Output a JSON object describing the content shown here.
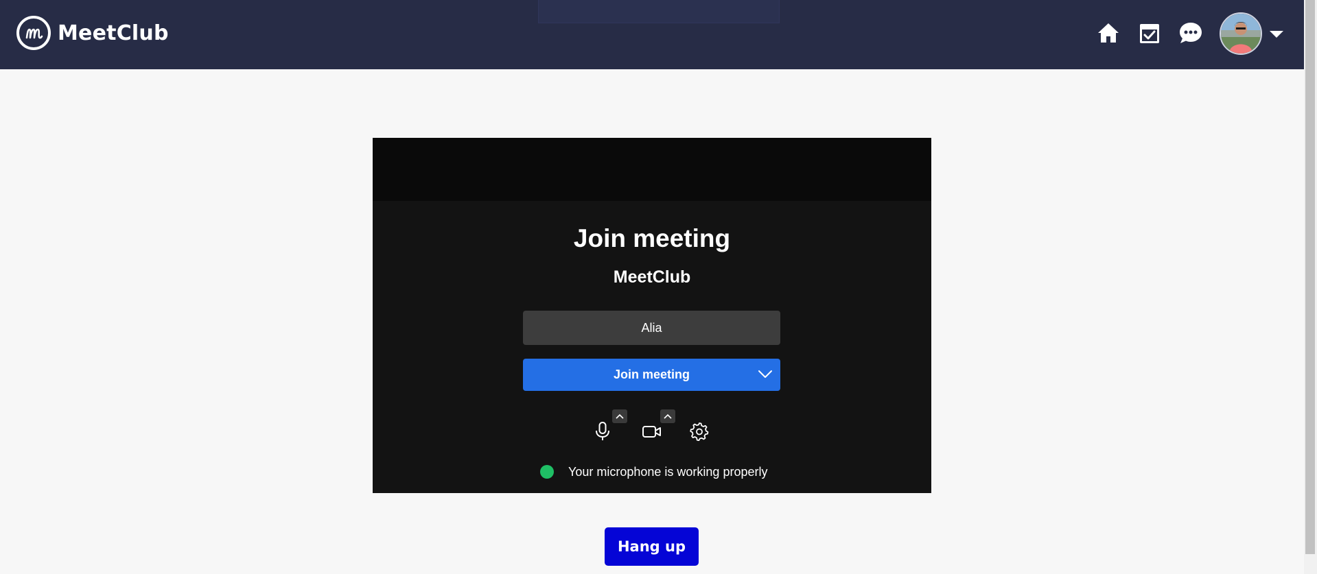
{
  "header": {
    "brand_name": "MeetClub",
    "logo_icon": "meetclub-logo-icon",
    "nav_icons": [
      "home-icon",
      "calendar-check-icon",
      "chat-bubble-icon"
    ],
    "avatar": "user-avatar",
    "menu_icon": "caret-down-icon",
    "background_color": "#272c46"
  },
  "join_panel": {
    "title": "Join meeting",
    "subtitle": "MeetClub",
    "name_input_value": "Alia",
    "join_button_label": "Join meeting",
    "controls": [
      "microphone-icon",
      "camera-icon",
      "settings-gear-icon"
    ],
    "status_text": "Your microphone is working properly",
    "status_color": "#1fbf65",
    "accent_color": "#246fe5"
  },
  "footer": {
    "hangup_label": "Hang up",
    "hangup_color": "#0505d6"
  }
}
